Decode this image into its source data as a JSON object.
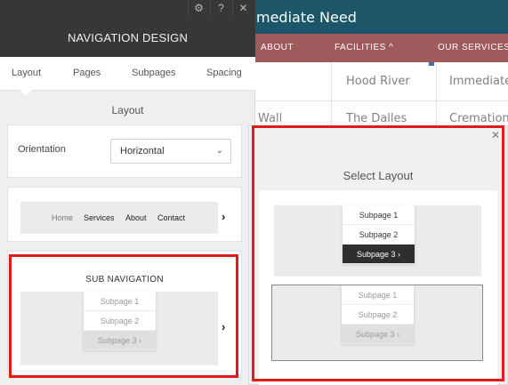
{
  "site": {
    "title": "mediate Need",
    "nav": [
      "ABOUT",
      "FACILITIES ^",
      "OUR SERVICES"
    ],
    "grid": {
      "row1": [
        "",
        "Hood River",
        "Immediate"
      ],
      "row2": [
        "Wall",
        "The Dalles",
        "Cremation"
      ]
    }
  },
  "panel": {
    "topbar_icons": [
      "gear-icon",
      "help-icon",
      "close-icon"
    ],
    "topbar_glyphs": [
      "⚙",
      "?",
      "✕"
    ],
    "title": "NAVIGATION DESIGN",
    "tabs": [
      "Layout",
      "Pages",
      "Subpages",
      "Spacing"
    ],
    "section_title": "Layout",
    "orientation": {
      "label": "Orientation",
      "value": "Horizontal",
      "chevron": "⌄"
    },
    "preview_links": [
      "Home",
      "Services",
      "About",
      "Contact"
    ],
    "subnav": {
      "title": "SUB NAVIGATION",
      "items": [
        "Subpage 1",
        "Subpage 2",
        "Subpage 3 ›"
      ]
    },
    "chevron": "›"
  },
  "popup": {
    "close": "✕",
    "title": "Select Layout",
    "option1_items": [
      "Subpage 1",
      "Subpage 2",
      "Subpage 3 ›"
    ],
    "option2_items": [
      "Subpage 1",
      "Subpage 2",
      "Subpage 3 ›"
    ]
  },
  "colors": {
    "header": "#1d5669",
    "nav": "#a05a5c",
    "panel_dark": "#373737",
    "highlight": "#e11b1b"
  }
}
